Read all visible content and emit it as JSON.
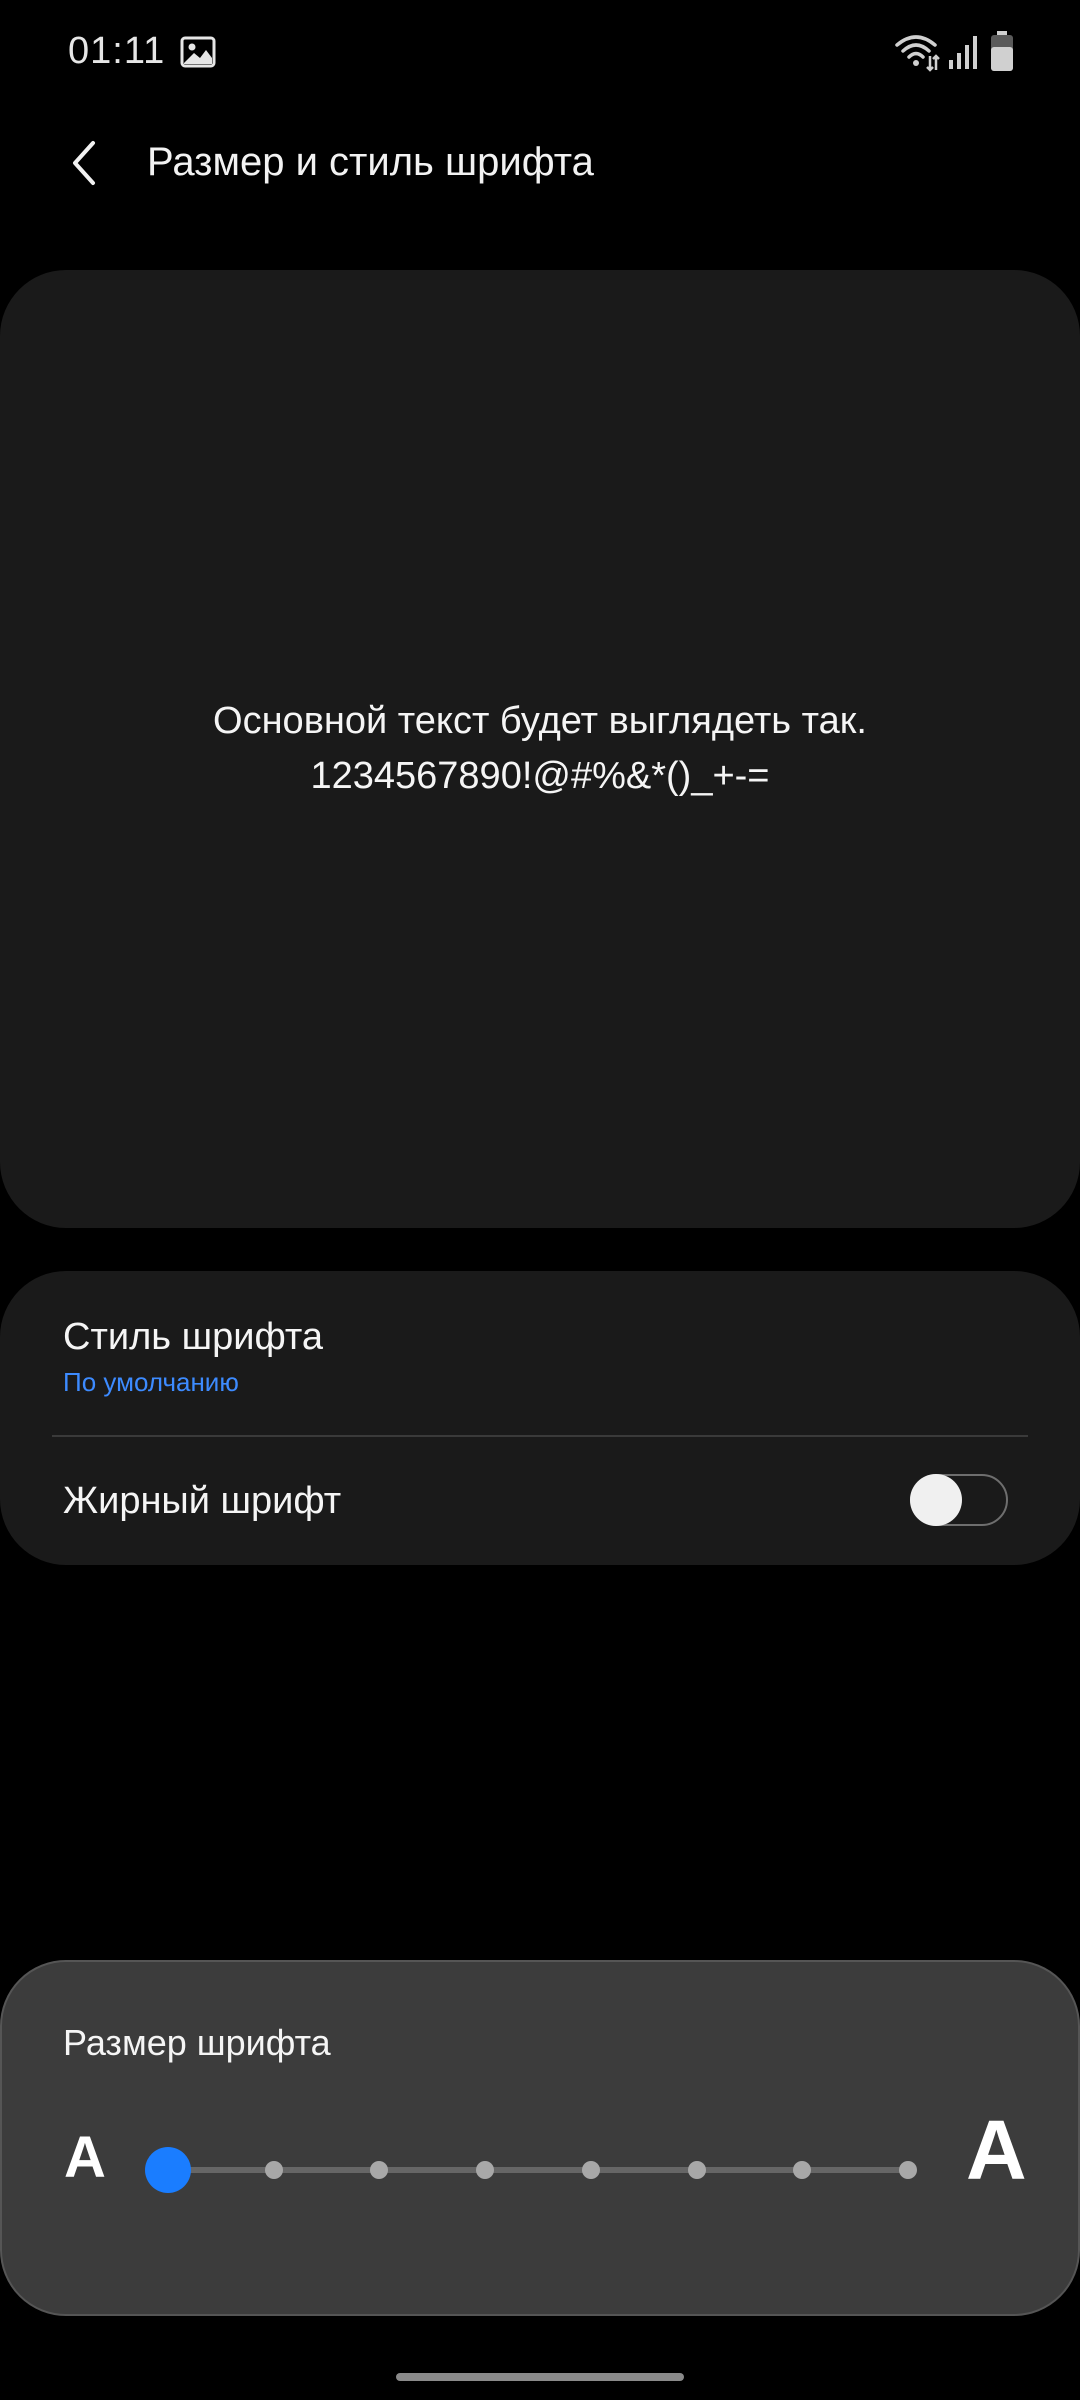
{
  "status_bar": {
    "time": "01:11",
    "icons": [
      "gallery-icon",
      "wifi-icon",
      "signal-icon",
      "battery-icon"
    ]
  },
  "app_bar": {
    "back_icon": "chevron-left-icon",
    "title": "Размер и стиль шрифта"
  },
  "preview": {
    "line1": "Основной текст будет выглядеть так.",
    "line2": "1234567890!@#%&*()_+-="
  },
  "settings": {
    "font_style": {
      "label": "Стиль шрифта",
      "value": "По умолчанию"
    },
    "bold_font": {
      "label": "Жирный шрифт",
      "enabled": false
    }
  },
  "font_size": {
    "title": "Размер шрифта",
    "small_glyph": "A",
    "large_glyph": "A",
    "steps": 8,
    "selected_step": 1
  },
  "colors": {
    "background": "#000000",
    "card": "#1a1a1a",
    "panel": "#3c3c3c",
    "accent": "#3d8bff",
    "slider_thumb": "#1a7dff"
  }
}
